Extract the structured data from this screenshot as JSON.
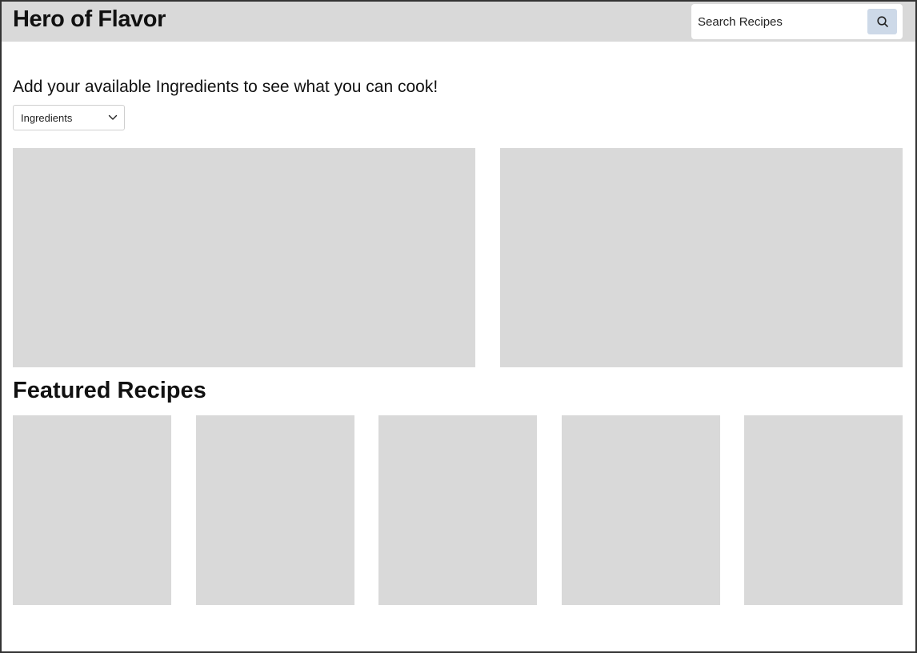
{
  "header": {
    "title": "Hero of Flavor",
    "search": {
      "placeholder": "Search Recipes",
      "value": "",
      "icon": "search-icon"
    }
  },
  "main": {
    "prompt": "Add your available Ingredients to see what you can cook!",
    "ingredients_dropdown": {
      "selected": "Ingredients",
      "icon": "chevron-down-icon"
    },
    "featured_title": "Featured Recipes"
  },
  "colors": {
    "header_bg": "#d9d9d9",
    "placeholder": "#d9d9d9",
    "search_button": "#cdd9e8"
  }
}
